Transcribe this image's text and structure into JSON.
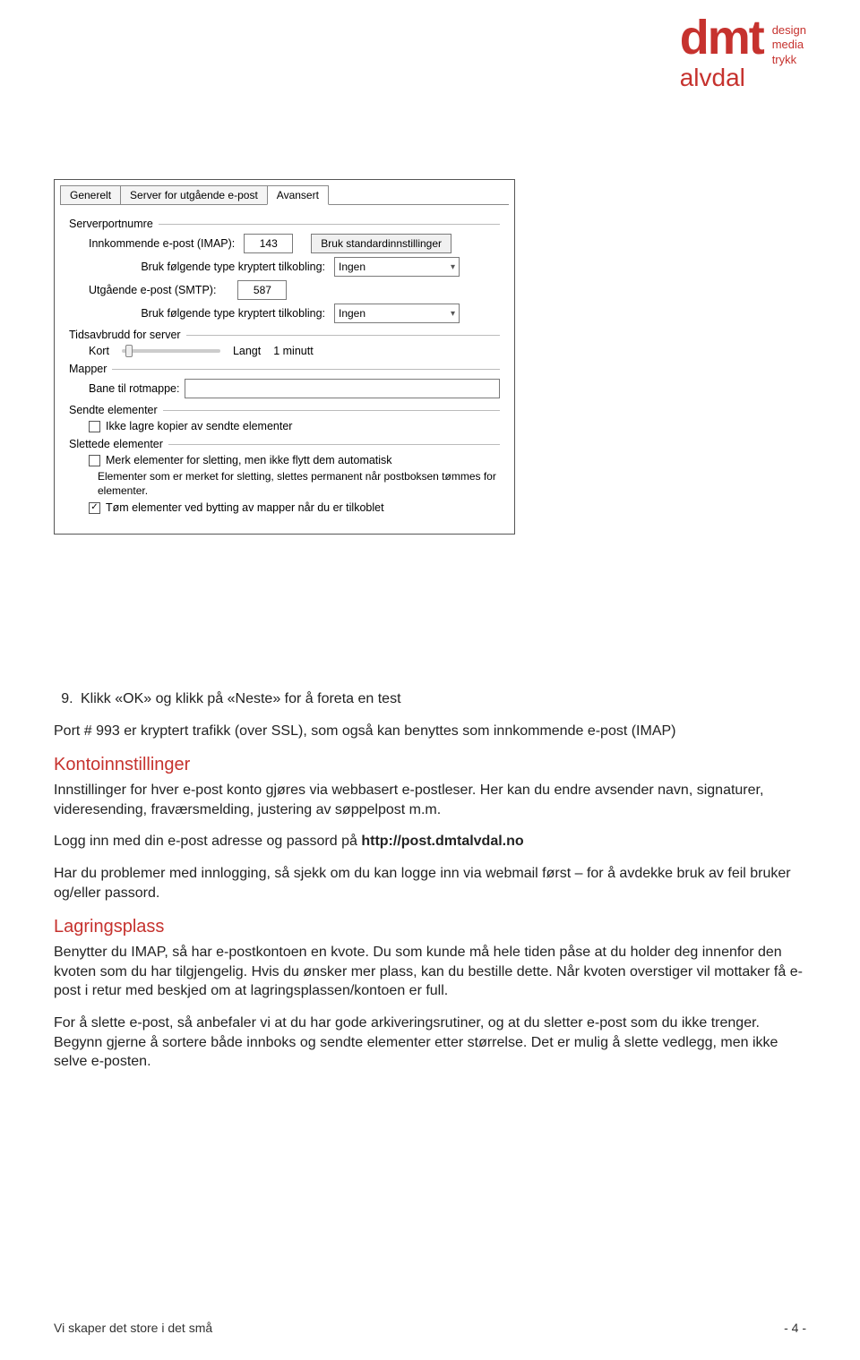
{
  "logo": {
    "main": "dmt",
    "tag1": "design",
    "tag2": "media",
    "tag3": "trykk",
    "sub": "alvdal"
  },
  "dialog": {
    "tabs": {
      "generelt": "Generelt",
      "utgaende": "Server for utgående e-post",
      "avansert": "Avansert"
    },
    "group_serverport": "Serverportnumre",
    "imap_label": "Innkommende e-post (IMAP):",
    "imap_value": "143",
    "std_button": "Bruk standardinnstillinger",
    "enc_label": "Bruk følgende type kryptert tilkobling:",
    "enc_value": "Ingen",
    "smtp_label": "Utgående e-post (SMTP):",
    "smtp_value": "587",
    "group_timeout": "Tidsavbrudd for server",
    "timeout_short": "Kort",
    "timeout_long": "Langt",
    "timeout_val": "1 minutt",
    "group_folders": "Mapper",
    "rootpath_label": "Bane til rotmappe:",
    "rootpath_value": "",
    "group_sent": "Sendte elementer",
    "sent_cb": "Ikke lagre kopier av sendte elementer",
    "group_deleted": "Slettede elementer",
    "del_cb1": "Merk elementer for sletting, men ikke flytt dem automatisk",
    "del_note": "Elementer som er merket for sletting, slettes permanent når postboksen tømmes for elementer.",
    "del_cb2": "Tøm elementer ved bytting av mapper når du er tilkoblet"
  },
  "body": {
    "li9": "Klikk «OK» og klikk på «Neste» for å foreta en test",
    "port_note": "Port # 993 er kryptert trafikk (over SSL), som også kan benyttes som innkommende e-post (IMAP)",
    "h_konto": "Kontoinnstillinger",
    "konto_p1": "Innstillinger for hver e-post konto gjøres via webbasert e-postleser. Her kan du endre avsender navn, signaturer, videresending, fraværsmelding, justering av søppelpost m.m.",
    "konto_p2a": "Logg inn med din e-post adresse og passord på ",
    "konto_p2b": "http://post.dmtalvdal.no",
    "konto_p3": "Har du problemer med innlogging, så sjekk om du kan logge inn via webmail først – for å avdekke bruk av feil bruker og/eller passord.",
    "h_lagring": "Lagringsplass",
    "lag_p1": "Benytter du IMAP, så har e-postkontoen en kvote. Du som kunde må hele tiden påse at du holder deg innenfor den kvoten som du har tilgjengelig. Hvis du ønsker mer plass, kan du bestille dette. Når kvoten overstiger vil mottaker få e-post i retur med beskjed om at lagringsplassen/kontoen er full.",
    "lag_p2": "For å slette e-post, så anbefaler vi at du har gode arkiveringsrutiner, og at du sletter e-post som du ikke trenger. Begynn gjerne å sortere både innboks og sendte elementer etter størrelse. Det er mulig å slette vedlegg, men ikke selve e-posten."
  },
  "footer": {
    "left": "Vi skaper det store i det små",
    "right": "- 4 -"
  }
}
